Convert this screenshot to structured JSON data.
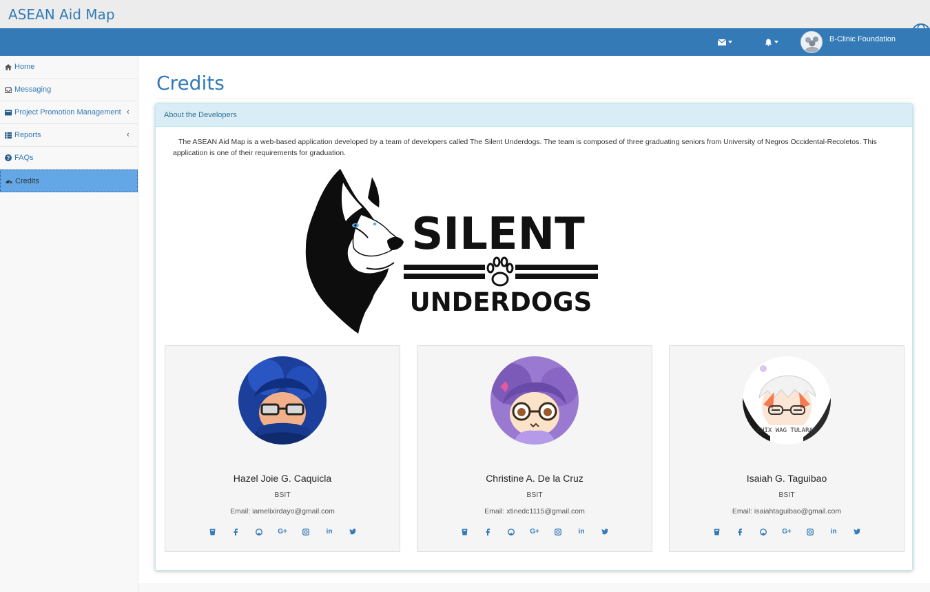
{
  "app": {
    "title": "ASEAN Aid Map"
  },
  "navbar": {
    "mail_icon": "envelope-icon",
    "bell_icon": "bell-icon",
    "user_name": "B-Clinic Foundation"
  },
  "sidebar": {
    "items": [
      {
        "label": "Home",
        "icon": "home-icon"
      },
      {
        "label": "Messaging",
        "icon": "inbox-icon"
      },
      {
        "label": "Project Promotion Management",
        "icon": "folder-icon",
        "expandable": true
      },
      {
        "label": "Reports",
        "icon": "table-icon",
        "expandable": true
      },
      {
        "label": "FAQs",
        "icon": "question-circle-icon"
      },
      {
        "label": "Credits",
        "icon": "dashboard-icon",
        "active": true
      }
    ]
  },
  "page": {
    "title": "Credits",
    "panel_heading": "About the Developers",
    "intro": "The ASEAN Aid Map is a web-based application developed by a team of developers called The Silent Underdogs. The team is composed of three graduating seniors from University of Negros Occidental-Recoletos. This application is one of their requirements for graduation.",
    "logo": {
      "line1": "SILENT",
      "line2": "UNDERDOGS"
    }
  },
  "developers": [
    {
      "name": "Hazel Joie G. Caquicla",
      "course": "BSIT",
      "email": "Email: iamelixirdayo@gmail.com"
    },
    {
      "name": "Christine A. De la Cruz",
      "course": "BSIT",
      "email": "Email: xtinedc1115@gmail.com"
    },
    {
      "name": "Isaiah G. Taguibao",
      "course": "BSIT",
      "email": "Email: isaiahtaguibao@gmail.com"
    }
  ],
  "social_icons": [
    "drupal-icon",
    "facebook-icon",
    "github-icon",
    "google-plus-icon",
    "instagram-icon",
    "linkedin-icon",
    "twitter-icon"
  ],
  "avatar_text": "CHIX WAG TULARAN",
  "colors": {
    "primary": "#337ab7",
    "active_menu": "#63a7e6",
    "panel_heading": "#d9edf7"
  }
}
